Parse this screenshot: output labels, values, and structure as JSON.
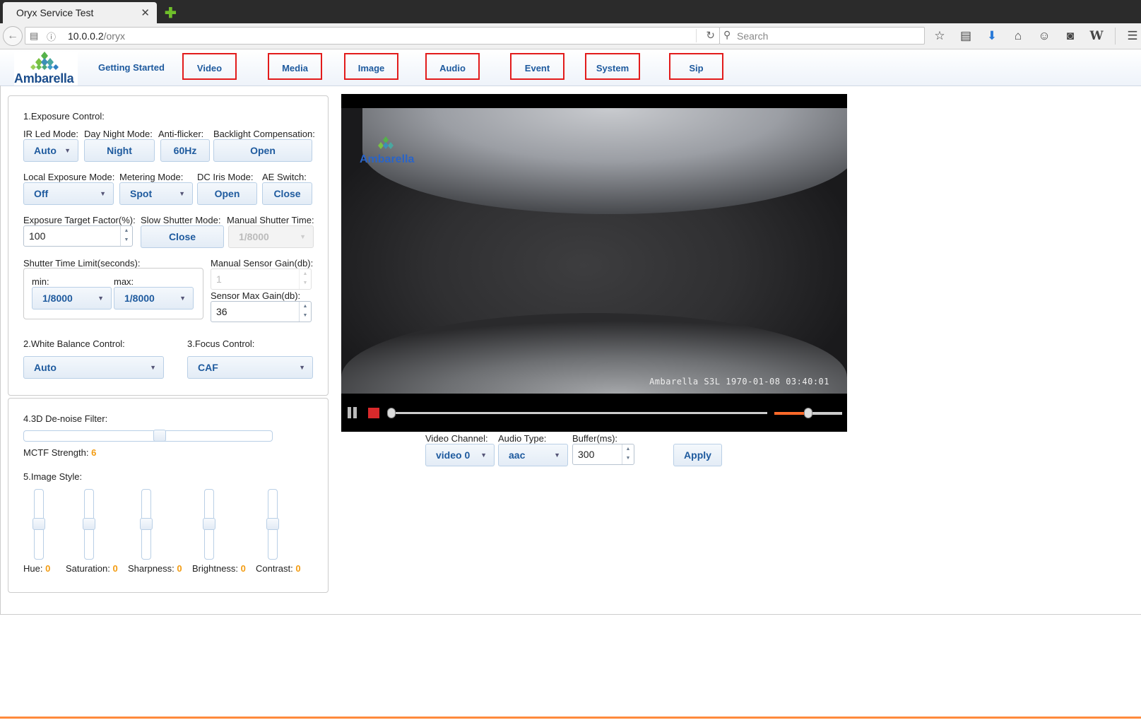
{
  "browser": {
    "tab_title": "Oryx Service Test",
    "url_host": "10.0.0.2",
    "url_path": "/oryx",
    "search_placeholder": "Search"
  },
  "header": {
    "logo_text": "Ambarella",
    "nav": [
      "Getting Started",
      "Video",
      "Media",
      "Image",
      "Audio",
      "Event",
      "System",
      "Sip"
    ]
  },
  "exposure": {
    "title": "1.Exposure Control:",
    "ir_led_label": "IR Led Mode:",
    "ir_led_value": "Auto",
    "day_night_label": "Day Night Mode:",
    "day_night_value": "Night",
    "anti_flicker_label": "Anti-flicker:",
    "anti_flicker_value": "60Hz",
    "backlight_label": "Backlight Compensation:",
    "backlight_value": "Open",
    "local_exposure_label": "Local Exposure Mode:",
    "local_exposure_value": "Off",
    "metering_label": "Metering Mode:",
    "metering_value": "Spot",
    "dc_iris_label": "DC Iris Mode:",
    "dc_iris_value": "Open",
    "ae_switch_label": "AE Switch:",
    "ae_switch_value": "Close",
    "target_factor_label": "Exposure Target Factor(%):",
    "target_factor_value": "100",
    "slow_shutter_label": "Slow Shutter Mode:",
    "slow_shutter_value": "Close",
    "manual_shutter_label": "Manual Shutter Time:",
    "manual_shutter_value": "1/8000",
    "shutter_limit_label": "Shutter Time Limit(seconds):",
    "min_label": "min:",
    "min_value": "1/8000",
    "max_label": "max:",
    "max_value": "1/8000",
    "manual_gain_label": "Manual Sensor Gain(db):",
    "manual_gain_value": "1",
    "max_gain_label": "Sensor Max Gain(db):",
    "max_gain_value": "36"
  },
  "white_balance": {
    "title": "2.White Balance Control:",
    "value": "Auto"
  },
  "focus": {
    "title": "3.Focus Control:",
    "value": "CAF"
  },
  "denoise": {
    "title": "4.3D De-noise Filter:",
    "strength_label": "MCTF Strength:",
    "strength_value": "6",
    "slider_fraction": 0.55
  },
  "image_style": {
    "title": "5.Image Style:",
    "sliders": [
      {
        "label": "Hue:",
        "value": "0"
      },
      {
        "label": "Saturation:",
        "value": "0"
      },
      {
        "label": "Sharpness:",
        "value": "0"
      },
      {
        "label": "Brightness:",
        "value": "0"
      },
      {
        "label": "Contrast:",
        "value": "0"
      }
    ]
  },
  "video": {
    "logo_text": "Ambarella",
    "osd_text": "Ambarella S3L 1970-01-08 03:40:01",
    "progress_fraction": 0.0,
    "volume_fraction": 0.5
  },
  "stream": {
    "channel_label": "Video Channel:",
    "channel_value": "video 0",
    "audio_label": "Audio Type:",
    "audio_value": "aac",
    "buffer_label": "Buffer(ms):",
    "buffer_value": "300",
    "apply_label": "Apply"
  },
  "colors": {
    "accent": "#1e5a9e",
    "highlight_box": "#e21b1b",
    "value_orange": "#f39c12",
    "volume": "#ff6a2a"
  }
}
